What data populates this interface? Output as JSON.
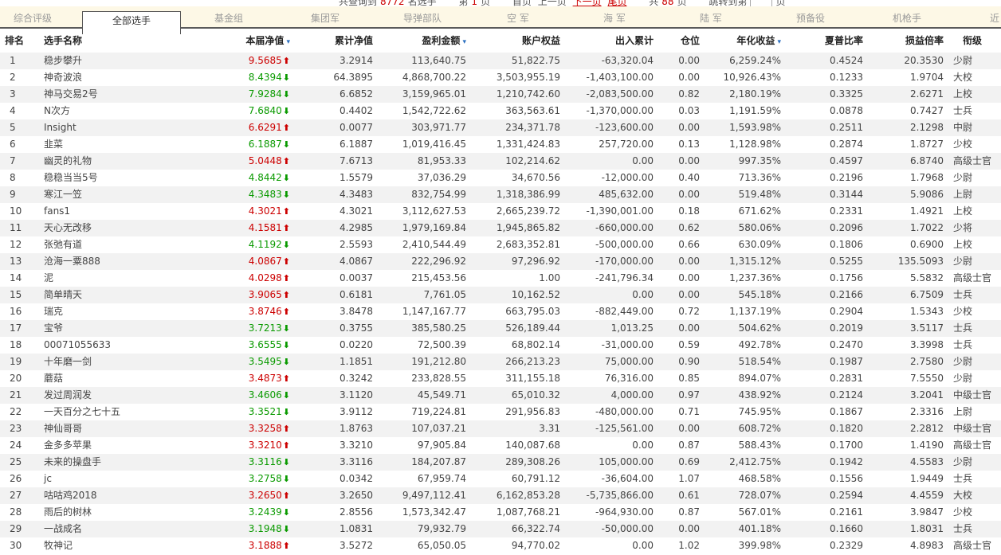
{
  "pager": {
    "total_prefix": "共查询到",
    "total_count": "8772",
    "total_suffix": "名选手",
    "page_prefix": "第",
    "page_num": "1",
    "page_suffix": "页",
    "first": "首页",
    "prev": "上一页",
    "next": "下一页",
    "last": "尾页",
    "pages_prefix": "共",
    "pages_count": "88",
    "pages_suffix": "页",
    "jump_label": "跳转到第",
    "jump_suffix": "页"
  },
  "tabs": [
    "综合评级",
    "全部选手",
    "基金组",
    "集团军",
    "导弹部队",
    "空 军",
    "海 军",
    "陆 军",
    "预备役",
    "机枪手",
    "近"
  ],
  "active_tab": 1,
  "columns": [
    "排名",
    "选手名称",
    "本届净值",
    "累计净值",
    "盈利金额",
    "账户权益",
    "出入累计",
    "仓位",
    "年化收益",
    "夏普比率",
    "损益倍率",
    "衔级"
  ],
  "colors": {
    "up": "#cc0000",
    "down": "#0a9a00",
    "sort_arrow": "#2a6ebf"
  },
  "rows": [
    {
      "rank": "1",
      "name": "稳步攀升",
      "nav": "9.5685",
      "dir": "up",
      "cum": "3.2914",
      "profit": "113,640.75",
      "equity": "51,822.75",
      "flow": "-63,320.04",
      "pos": "0.00",
      "annual": "6,259.24%",
      "sharpe": "0.4524",
      "ratio": "20.3530",
      "grade": "少尉"
    },
    {
      "rank": "2",
      "name": "神奇波浪",
      "nav": "8.4394",
      "dir": "down",
      "cum": "64.3895",
      "profit": "4,868,700.22",
      "equity": "3,503,955.19",
      "flow": "-1,403,100.00",
      "pos": "0.00",
      "annual": "10,926.43%",
      "sharpe": "0.1233",
      "ratio": "1.9704",
      "grade": "大校"
    },
    {
      "rank": "3",
      "name": "神马交易2号",
      "nav": "7.9284",
      "dir": "down",
      "cum": "6.6852",
      "profit": "3,159,965.01",
      "equity": "1,210,742.60",
      "flow": "-2,083,500.00",
      "pos": "0.82",
      "annual": "2,180.19%",
      "sharpe": "0.3325",
      "ratio": "2.6271",
      "grade": "上校"
    },
    {
      "rank": "4",
      "name": "N次方",
      "nav": "7.6840",
      "dir": "down",
      "cum": "0.4402",
      "profit": "1,542,722.62",
      "equity": "363,563.61",
      "flow": "-1,370,000.00",
      "pos": "0.03",
      "annual": "1,191.59%",
      "sharpe": "0.0878",
      "ratio": "0.7427",
      "grade": "士兵"
    },
    {
      "rank": "5",
      "name": "Insight",
      "nav": "6.6291",
      "dir": "up",
      "cum": "0.0077",
      "profit": "303,971.77",
      "equity": "234,371.78",
      "flow": "-123,600.00",
      "pos": "0.00",
      "annual": "1,593.98%",
      "sharpe": "0.2511",
      "ratio": "2.1298",
      "grade": "中尉"
    },
    {
      "rank": "6",
      "name": "韭菜",
      "nav": "6.1887",
      "dir": "down",
      "cum": "6.1887",
      "profit": "1,019,416.45",
      "equity": "1,331,424.83",
      "flow": "257,720.00",
      "pos": "0.13",
      "annual": "1,128.98%",
      "sharpe": "0.2874",
      "ratio": "1.8727",
      "grade": "少校"
    },
    {
      "rank": "7",
      "name": "幽灵的礼物",
      "nav": "5.0448",
      "dir": "up",
      "cum": "7.6713",
      "profit": "81,953.33",
      "equity": "102,214.62",
      "flow": "0.00",
      "pos": "0.00",
      "annual": "997.35%",
      "sharpe": "0.4597",
      "ratio": "6.8740",
      "grade": "高级士官"
    },
    {
      "rank": "8",
      "name": "稳稳当当5号",
      "nav": "4.8442",
      "dir": "down",
      "cum": "1.5579",
      "profit": "37,036.29",
      "equity": "34,670.56",
      "flow": "-12,000.00",
      "pos": "0.40",
      "annual": "713.36%",
      "sharpe": "0.2196",
      "ratio": "1.7968",
      "grade": "少尉"
    },
    {
      "rank": "9",
      "name": "寒江一笠",
      "nav": "4.3483",
      "dir": "down",
      "cum": "4.3483",
      "profit": "832,754.99",
      "equity": "1,318,386.99",
      "flow": "485,632.00",
      "pos": "0.00",
      "annual": "519.48%",
      "sharpe": "0.3144",
      "ratio": "5.9086",
      "grade": "上尉"
    },
    {
      "rank": "10",
      "name": "fans1",
      "nav": "4.3021",
      "dir": "up",
      "cum": "4.3021",
      "profit": "3,112,627.53",
      "equity": "2,665,239.72",
      "flow": "-1,390,001.00",
      "pos": "0.18",
      "annual": "671.62%",
      "sharpe": "0.2331",
      "ratio": "1.4921",
      "grade": "上校"
    },
    {
      "rank": "11",
      "name": "天心无改移",
      "nav": "4.1581",
      "dir": "up",
      "cum": "4.2985",
      "profit": "1,979,169.84",
      "equity": "1,945,865.82",
      "flow": "-660,000.00",
      "pos": "0.62",
      "annual": "580.06%",
      "sharpe": "0.2096",
      "ratio": "1.7022",
      "grade": "少将"
    },
    {
      "rank": "12",
      "name": "张弛有道",
      "nav": "4.1192",
      "dir": "down",
      "cum": "2.5593",
      "profit": "2,410,544.49",
      "equity": "2,683,352.81",
      "flow": "-500,000.00",
      "pos": "0.66",
      "annual": "630.09%",
      "sharpe": "0.1806",
      "ratio": "0.6900",
      "grade": "上校"
    },
    {
      "rank": "13",
      "name": "沧海一粟888",
      "nav": "4.0867",
      "dir": "up",
      "cum": "4.0867",
      "profit": "222,296.92",
      "equity": "97,296.92",
      "flow": "-170,000.00",
      "pos": "0.00",
      "annual": "1,315.12%",
      "sharpe": "0.5255",
      "ratio": "135.5093",
      "grade": "少尉"
    },
    {
      "rank": "14",
      "name": "泥",
      "nav": "4.0298",
      "dir": "up",
      "cum": "0.0037",
      "profit": "215,453.56",
      "equity": "1.00",
      "flow": "-241,796.34",
      "pos": "0.00",
      "annual": "1,237.36%",
      "sharpe": "0.1756",
      "ratio": "5.5832",
      "grade": "高级士官"
    },
    {
      "rank": "15",
      "name": "简单晴天",
      "nav": "3.9065",
      "dir": "up",
      "cum": "0.6181",
      "profit": "7,761.05",
      "equity": "10,162.52",
      "flow": "0.00",
      "pos": "0.00",
      "annual": "545.18%",
      "sharpe": "0.2166",
      "ratio": "6.7509",
      "grade": "士兵"
    },
    {
      "rank": "16",
      "name": "瑞克",
      "nav": "3.8746",
      "dir": "up",
      "cum": "3.8478",
      "profit": "1,147,167.77",
      "equity": "663,795.03",
      "flow": "-882,449.00",
      "pos": "0.72",
      "annual": "1,137.19%",
      "sharpe": "0.2904",
      "ratio": "1.5343",
      "grade": "少校"
    },
    {
      "rank": "17",
      "name": "宝爷",
      "nav": "3.7213",
      "dir": "down",
      "cum": "0.3755",
      "profit": "385,580.25",
      "equity": "526,189.44",
      "flow": "1,013.25",
      "pos": "0.00",
      "annual": "504.62%",
      "sharpe": "0.2019",
      "ratio": "3.5117",
      "grade": "士兵"
    },
    {
      "rank": "18",
      "name": "00071055633",
      "nav": "3.6555",
      "dir": "down",
      "cum": "0.0220",
      "profit": "72,500.39",
      "equity": "68,802.14",
      "flow": "-31,000.00",
      "pos": "0.59",
      "annual": "492.78%",
      "sharpe": "0.2470",
      "ratio": "3.3998",
      "grade": "士兵"
    },
    {
      "rank": "19",
      "name": "十年磨一剑",
      "nav": "3.5495",
      "dir": "down",
      "cum": "1.1851",
      "profit": "191,212.80",
      "equity": "266,213.23",
      "flow": "75,000.00",
      "pos": "0.90",
      "annual": "518.54%",
      "sharpe": "0.1987",
      "ratio": "2.7580",
      "grade": "少尉"
    },
    {
      "rank": "20",
      "name": "蘑菇",
      "nav": "3.4873",
      "dir": "up",
      "cum": "0.3242",
      "profit": "233,828.55",
      "equity": "311,155.18",
      "flow": "76,316.00",
      "pos": "0.85",
      "annual": "894.07%",
      "sharpe": "0.2831",
      "ratio": "7.5550",
      "grade": "少尉"
    },
    {
      "rank": "21",
      "name": "发过周润发",
      "nav": "3.4606",
      "dir": "down",
      "cum": "3.1120",
      "profit": "45,549.71",
      "equity": "65,010.32",
      "flow": "4,000.00",
      "pos": "0.97",
      "annual": "438.92%",
      "sharpe": "0.2124",
      "ratio": "3.2041",
      "grade": "中级士官"
    },
    {
      "rank": "22",
      "name": "一天百分之七十五",
      "nav": "3.3521",
      "dir": "down",
      "cum": "3.9112",
      "profit": "719,224.81",
      "equity": "291,956.83",
      "flow": "-480,000.00",
      "pos": "0.71",
      "annual": "745.95%",
      "sharpe": "0.1867",
      "ratio": "2.3316",
      "grade": "上尉"
    },
    {
      "rank": "23",
      "name": "神仙哥哥",
      "nav": "3.3258",
      "dir": "up",
      "cum": "1.8763",
      "profit": "107,037.21",
      "equity": "3.31",
      "flow": "-125,561.00",
      "pos": "0.00",
      "annual": "608.72%",
      "sharpe": "0.1820",
      "ratio": "2.2812",
      "grade": "中级士官"
    },
    {
      "rank": "24",
      "name": "金多多苹果",
      "nav": "3.3210",
      "dir": "up",
      "cum": "3.3210",
      "profit": "97,905.84",
      "equity": "140,087.68",
      "flow": "0.00",
      "pos": "0.87",
      "annual": "588.43%",
      "sharpe": "0.1700",
      "ratio": "1.4190",
      "grade": "高级士官"
    },
    {
      "rank": "25",
      "name": "未来的操盘手",
      "nav": "3.3116",
      "dir": "down",
      "cum": "3.3116",
      "profit": "184,207.87",
      "equity": "289,308.26",
      "flow": "105,000.00",
      "pos": "0.69",
      "annual": "2,412.75%",
      "sharpe": "0.1942",
      "ratio": "4.5583",
      "grade": "少尉"
    },
    {
      "rank": "26",
      "name": "jc",
      "nav": "3.2758",
      "dir": "down",
      "cum": "0.0342",
      "profit": "67,959.74",
      "equity": "60,791.12",
      "flow": "-36,604.00",
      "pos": "1.07",
      "annual": "468.58%",
      "sharpe": "0.1556",
      "ratio": "1.9449",
      "grade": "士兵"
    },
    {
      "rank": "27",
      "name": "咕咕鸡2018",
      "nav": "3.2650",
      "dir": "up",
      "cum": "3.2650",
      "profit": "9,497,112.41",
      "equity": "6,162,853.28",
      "flow": "-5,735,866.00",
      "pos": "0.61",
      "annual": "728.07%",
      "sharpe": "0.2594",
      "ratio": "4.4559",
      "grade": "大校"
    },
    {
      "rank": "28",
      "name": "雨后的树林",
      "nav": "3.2439",
      "dir": "down",
      "cum": "2.8556",
      "profit": "1,573,342.47",
      "equity": "1,087,768.21",
      "flow": "-964,930.00",
      "pos": "0.87",
      "annual": "567.01%",
      "sharpe": "0.2161",
      "ratio": "3.9847",
      "grade": "少校"
    },
    {
      "rank": "29",
      "name": "一战成名",
      "nav": "3.1948",
      "dir": "down",
      "cum": "1.0831",
      "profit": "79,932.79",
      "equity": "66,322.74",
      "flow": "-50,000.00",
      "pos": "0.00",
      "annual": "401.18%",
      "sharpe": "0.1660",
      "ratio": "1.8031",
      "grade": "士兵"
    },
    {
      "rank": "30",
      "name": "牧神记",
      "nav": "3.1888",
      "dir": "up",
      "cum": "3.5272",
      "profit": "65,050.05",
      "equity": "94,770.02",
      "flow": "0.00",
      "pos": "1.02",
      "annual": "399.98%",
      "sharpe": "0.2329",
      "ratio": "4.8983",
      "grade": "高级士官"
    }
  ]
}
